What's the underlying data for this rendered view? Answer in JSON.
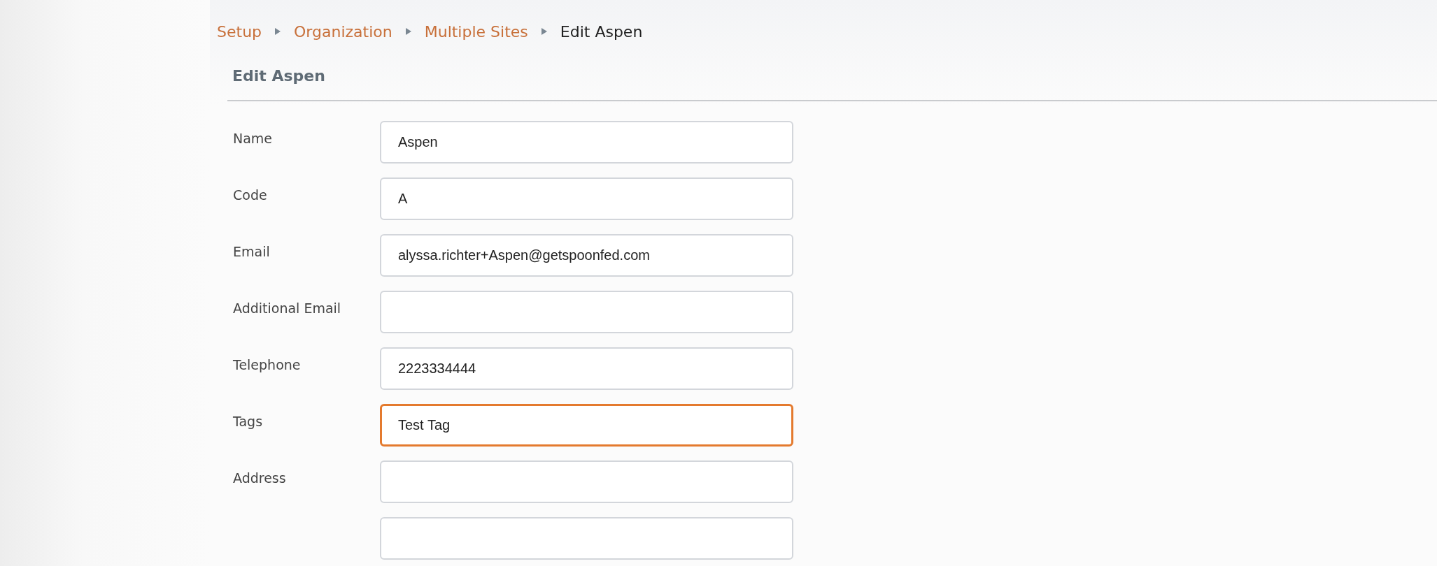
{
  "breadcrumb": [
    {
      "label": "Setup",
      "current": false
    },
    {
      "label": "Organization",
      "current": false
    },
    {
      "label": "Multiple Sites",
      "current": false
    },
    {
      "label": "Edit Aspen",
      "current": true
    }
  ],
  "heading": "Edit Aspen",
  "fields": [
    {
      "label": "Name",
      "value": "Aspen",
      "focused": false
    },
    {
      "label": "Code",
      "value": "A",
      "focused": false
    },
    {
      "label": "Email",
      "value": "alyssa.richter+Aspen@getspoonfed.com",
      "focused": false
    },
    {
      "label": "Additional Email",
      "focused": false
    },
    {
      "label": "Telephone",
      "value": "2223334444",
      "focused": false
    },
    {
      "label": "Tags",
      "value": "Test Tag",
      "focused": true
    },
    {
      "label": "Address",
      "focused": false
    },
    {
      "focused": false
    }
  ]
}
